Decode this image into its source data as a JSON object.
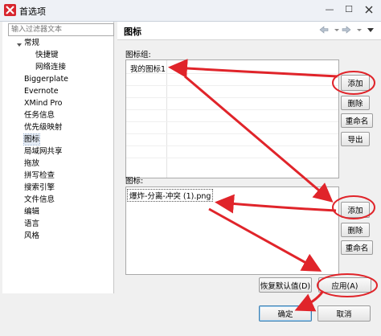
{
  "window": {
    "title": "首选项",
    "minimize_glyph": "—",
    "maximize_glyph": "☐"
  },
  "sidebar": {
    "filter_placeholder": "输入过滤器文本",
    "items": [
      {
        "label": "常规"
      },
      {
        "label": "快捷键"
      },
      {
        "label": "网络连接"
      },
      {
        "label": "Biggerplate"
      },
      {
        "label": "Evernote"
      },
      {
        "label": "XMind Pro"
      },
      {
        "label": "任务信息"
      },
      {
        "label": "优先级映射"
      },
      {
        "label": "图标"
      },
      {
        "label": "局域网共享"
      },
      {
        "label": "拖放"
      },
      {
        "label": "拼写检查"
      },
      {
        "label": "搜索引擎"
      },
      {
        "label": "文件信息"
      },
      {
        "label": "编辑"
      },
      {
        "label": "语言"
      },
      {
        "label": "风格"
      }
    ],
    "selected": "图标"
  },
  "main": {
    "title": "图标",
    "icon_groups": {
      "label": "图标组:",
      "items": [
        "我的图标1"
      ],
      "buttons": {
        "add": "添加",
        "delete": "删除",
        "rename": "重命名",
        "export": "导出"
      }
    },
    "icons": {
      "label": "图标:",
      "items": [
        "爆炸-分离-冲突 (1).png"
      ],
      "buttons": {
        "add": "添加",
        "delete": "删除",
        "rename": "重命名"
      }
    },
    "restore_defaults": "恢复默认值(D)",
    "apply": "应用(A)"
  },
  "footer": {
    "ok": "确定",
    "cancel": "取消"
  },
  "colors": {
    "annotation_red": "#e0242a",
    "selection_blue": "#3399ff",
    "title_bar_bg": "#eef1f6",
    "app_icon_red": "#d7262e"
  }
}
